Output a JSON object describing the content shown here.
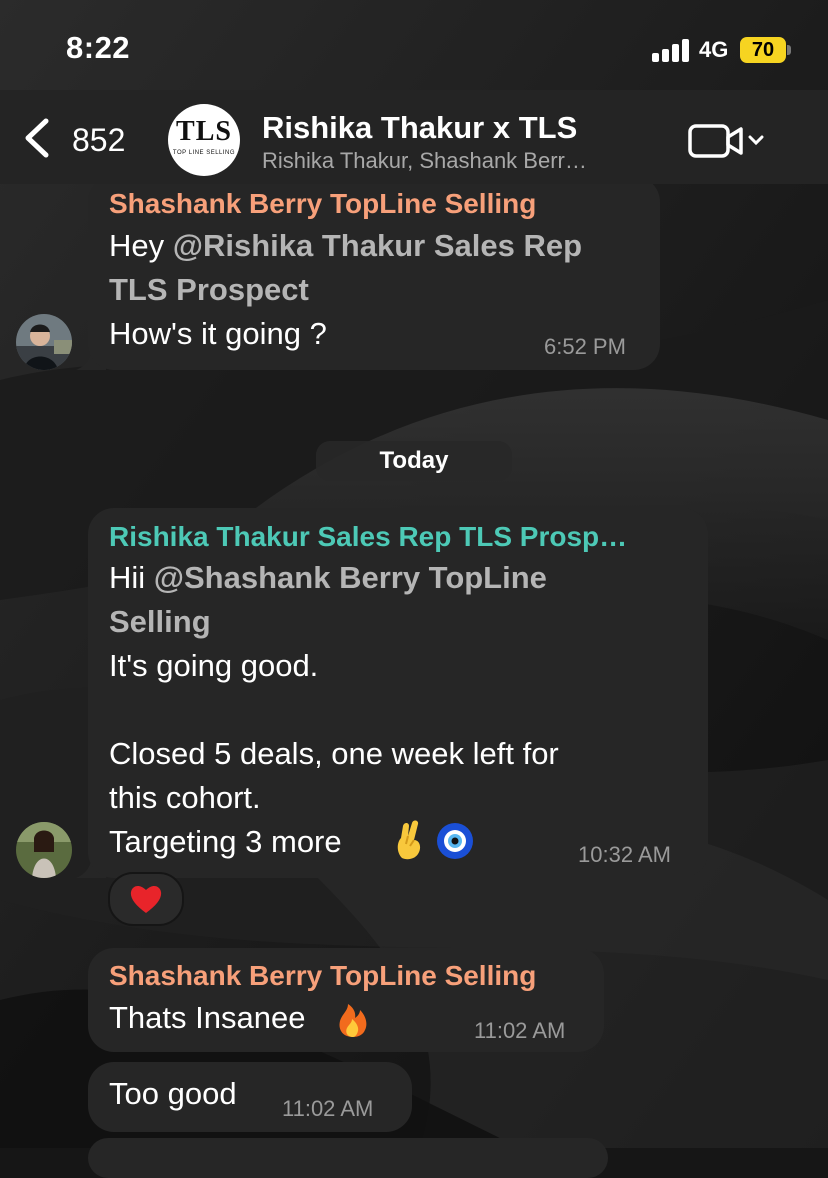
{
  "status_bar": {
    "time": "8:22",
    "network": "4G",
    "battery": "70"
  },
  "header": {
    "back_count": "852",
    "group_logo_text": "TLS",
    "group_logo_tagline": "TOP LINE SELLING",
    "title": "Rishika Thakur x TLS",
    "subtitle": "Rishika Thakur, Shashank Berr…"
  },
  "messages": [
    {
      "sender": "Shashank Berry TopLine Selling",
      "line1_prefix": "Hey ",
      "line1_mention": "@Rishika Thakur Sales Rep",
      "line2_mention": "TLS Prospect",
      "line3": "How's it going ?",
      "time": "6:52 PM"
    },
    {
      "sender": "Rishika Thakur Sales Rep TLS Prosp…",
      "line1_prefix": "Hii ",
      "line1_mention": "@Shashank Berry TopLine",
      "line2_mention": "Selling",
      "line3": "It's going good.",
      "line4": "Closed 5 deals, one week left for",
      "line5": "this cohort.",
      "line6": "Targeting 3 more",
      "time": "10:32 AM",
      "reaction": "❤️"
    },
    {
      "sender": "Shashank Berry TopLine Selling",
      "text": "Thats Insanee",
      "time": "11:02 AM"
    },
    {
      "text": "Too good",
      "time": "11:02 AM"
    }
  ],
  "day_separator": "Today",
  "colors": {
    "sender_orange": "#f7a07a",
    "sender_teal": "#4dc9b6",
    "battery": "#f6d421"
  },
  "icons": [
    "back-chevron-icon",
    "video-call-icon",
    "chevron-down-icon",
    "signal-icon",
    "battery-icon",
    "crossed-fingers-emoji",
    "nazar-amulet-emoji",
    "fire-emoji",
    "heart-emoji"
  ]
}
